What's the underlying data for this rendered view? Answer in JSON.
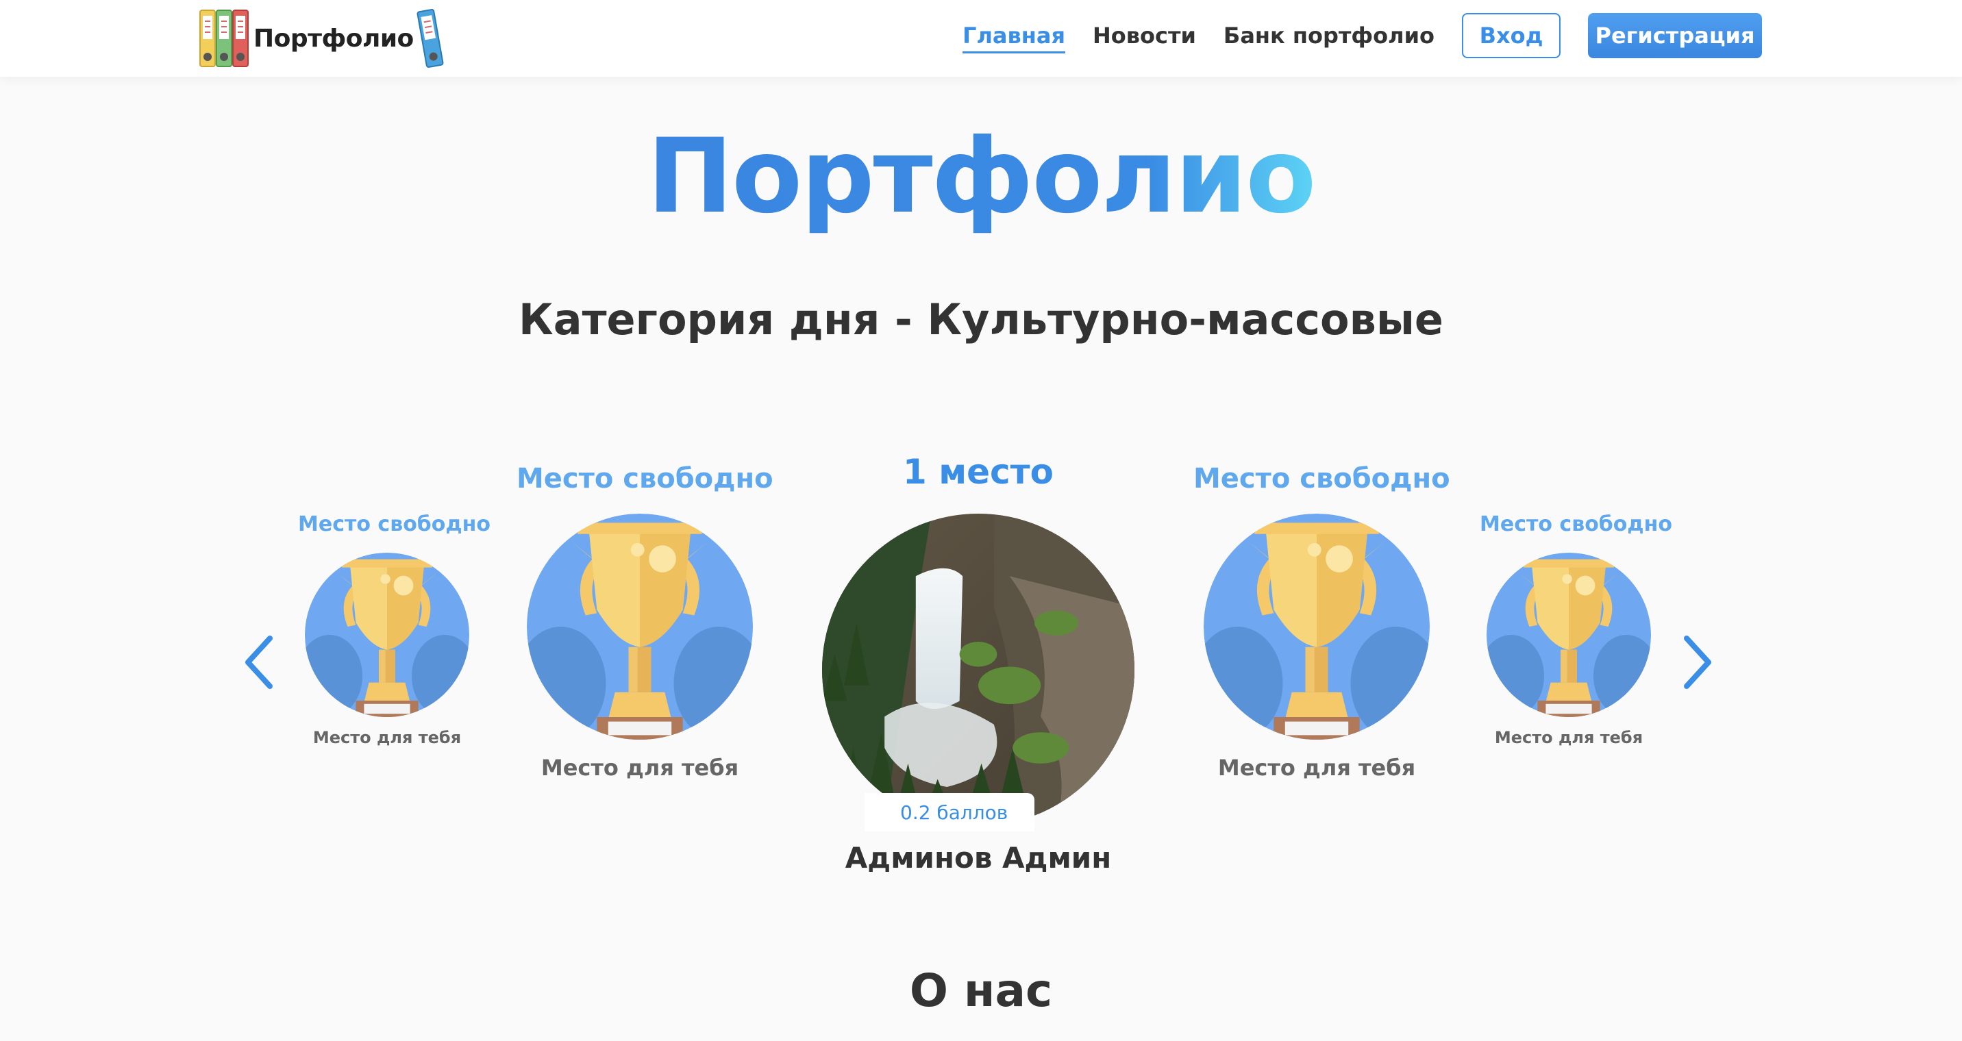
{
  "header": {
    "logo_text": "Портфолио",
    "nav": {
      "home": "Главная",
      "news": "Новости",
      "bank": "Банк портфолио"
    },
    "login_label": "Вход",
    "register_label": "Регистрация"
  },
  "hero": {
    "title": "Портфолио"
  },
  "category": {
    "title": "Категория дня - Культурно-массовые"
  },
  "carousel": {
    "free_place": "Место свободно",
    "place_for_you": "Место для тебя",
    "first_place": "1 место",
    "winner_points": "0.2 баллов",
    "winner_name": "Админов Админ"
  },
  "about": {
    "title": "О нас"
  },
  "colors": {
    "accent": "#3a8ee6",
    "light_accent": "#5fa8ee",
    "trophy_bg": "#6fa8f0",
    "trophy_gold": "#f5c96a"
  },
  "icons": [
    "binders-logo-icon",
    "chevron-left-icon",
    "chevron-right-icon",
    "trophy-icon"
  ]
}
